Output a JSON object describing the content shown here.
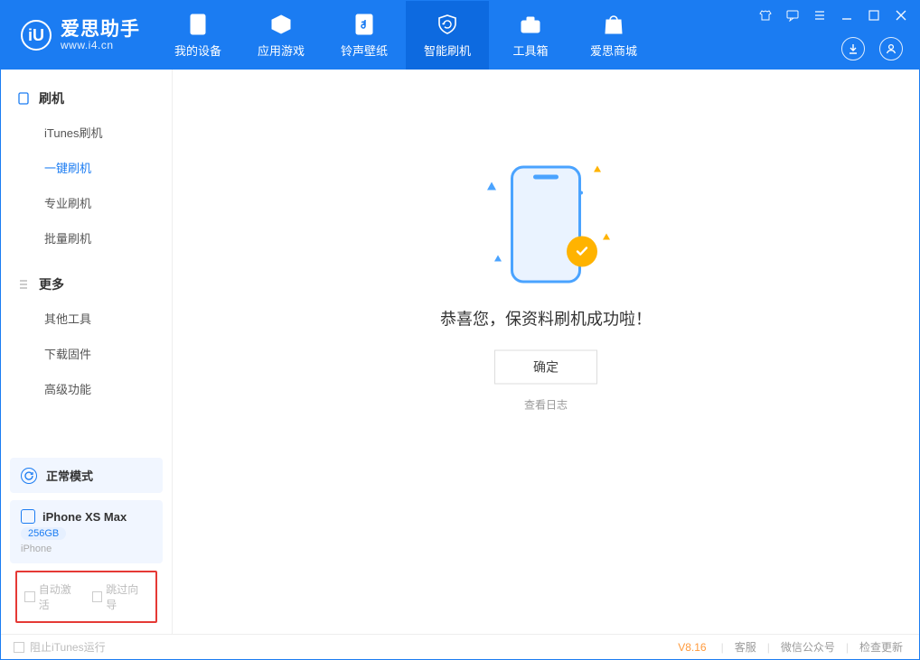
{
  "app": {
    "name": "爱思助手",
    "url": "www.i4.cn",
    "logo_letter": "iU"
  },
  "nav": [
    {
      "label": "我的设备"
    },
    {
      "label": "应用游戏"
    },
    {
      "label": "铃声壁纸"
    },
    {
      "label": "智能刷机"
    },
    {
      "label": "工具箱"
    },
    {
      "label": "爱思商城"
    }
  ],
  "sidebar": {
    "groups": [
      {
        "title": "刷机",
        "items": [
          "iTunes刷机",
          "一键刷机",
          "专业刷机",
          "批量刷机"
        ]
      },
      {
        "title": "更多",
        "items": [
          "其他工具",
          "下载固件",
          "高级功能"
        ]
      }
    ],
    "mode": "正常模式",
    "device": {
      "name": "iPhone XS Max",
      "capacity": "256GB",
      "type": "iPhone"
    },
    "options": {
      "auto_activate": "自动激活",
      "skip_guide": "跳过向导"
    }
  },
  "main": {
    "success_title": "恭喜您，保资料刷机成功啦！",
    "ok_button": "确定",
    "view_log": "查看日志"
  },
  "footer": {
    "block_itunes": "阻止iTunes运行",
    "version": "V8.16",
    "links": [
      "客服",
      "微信公众号",
      "检查更新"
    ]
  }
}
